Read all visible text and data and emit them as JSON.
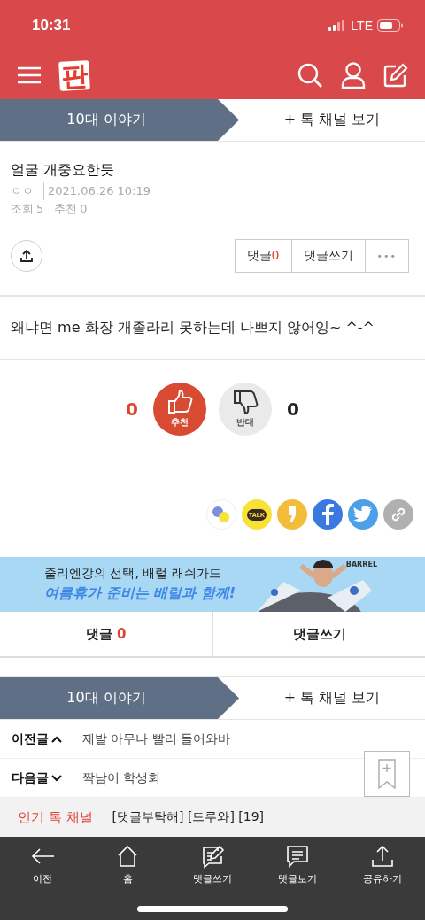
{
  "status_bar": {
    "time": "10:31",
    "network": "LTE"
  },
  "header": {
    "logo": "판"
  },
  "category_bar": {
    "category": "10대 이야기",
    "more": "+ 톡 채널 보기"
  },
  "post": {
    "title": "얼굴 개중요한듯",
    "author": "ㅇㅇ",
    "date": "2021.06.26 10:19",
    "views_label": "조회",
    "views": "5",
    "recommend_label": "추천",
    "recommend": "0",
    "actions": [
      {
        "kind": "count",
        "label": "댓글",
        "count": "0"
      },
      {
        "kind": "text",
        "label": "댓글쓰기"
      },
      {
        "kind": "more",
        "label": "•••"
      }
    ],
    "body": "왜냐면 me 화장 개졸라리 못하는데 나쁘지 않어잉~ ^-^"
  },
  "votes": {
    "up_count": "0",
    "up_label": "추천",
    "down_label": "반대",
    "down_count": "0"
  },
  "share_buttons": [
    {
      "kind": "chat"
    },
    {
      "kind": "talk",
      "label": "TALK"
    },
    {
      "kind": "story"
    },
    {
      "kind": "facebook"
    },
    {
      "kind": "twitter"
    },
    {
      "kind": "link"
    }
  ],
  "banner": {
    "line_1": "줄리엔강의 선택, 배럴 래쉬가드",
    "line_2": "여름휴가 준비는 배럴과 함께!",
    "brand": "BARREL"
  },
  "comment_bar": {
    "comments_label": "댓글",
    "comments_count": "0",
    "write_label": "댓글쓰기"
  },
  "category_bar_2": {
    "category": "10대 이야기",
    "more": "+ 톡 채널 보기"
  },
  "neighbors": [
    {
      "kind": "prev",
      "label": "이전글",
      "title": "제발 아무나 빨리 들어와바"
    },
    {
      "kind": "next",
      "label": "다음글",
      "title": "짝남이 학생회"
    }
  ],
  "popular": {
    "label": "인기 톡 채널",
    "text": "[댓글부탁해] [드루와] [19]"
  },
  "bottom_nav": [
    {
      "kind": "back",
      "label": "이전"
    },
    {
      "kind": "home",
      "label": "홈"
    },
    {
      "kind": "write",
      "label": "댓글쓰기"
    },
    {
      "kind": "view",
      "label": "댓글보기"
    },
    {
      "kind": "share",
      "label": "공유하기"
    }
  ]
}
